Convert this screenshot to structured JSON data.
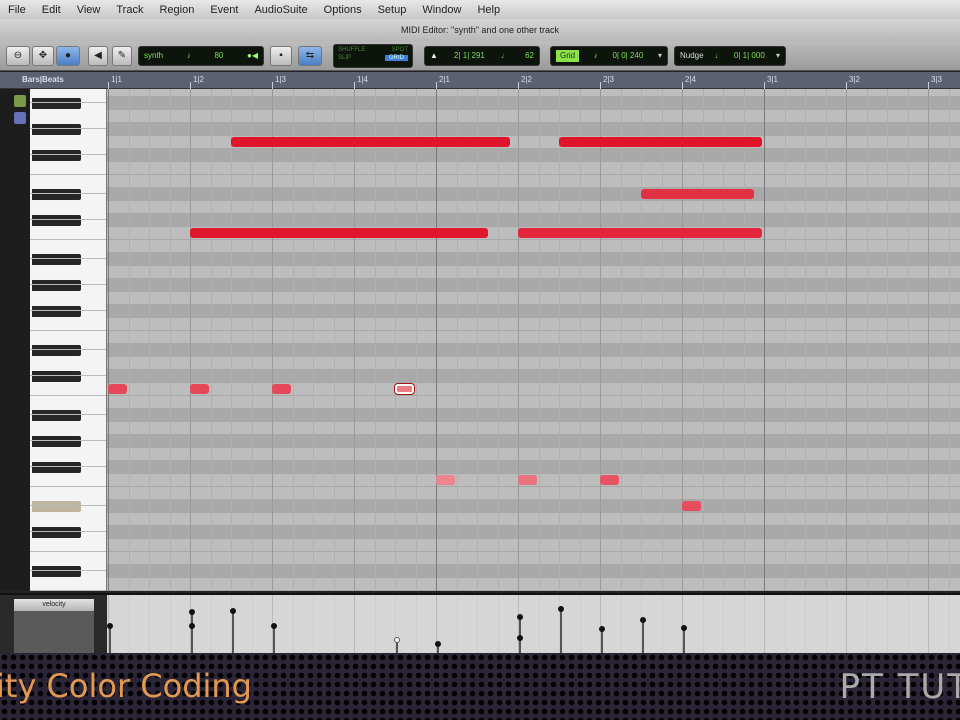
{
  "menu": [
    "File",
    "Edit",
    "View",
    "Track",
    "Region",
    "Event",
    "AudioSuite",
    "Options",
    "Setup",
    "Window",
    "Help"
  ],
  "window_title": "MIDI Editor: \"synth\" and one other track",
  "toolbar": {
    "track_lcd": {
      "name": "synth",
      "value": "80"
    },
    "mode_lcd": {
      "top_left": "SHUFFLE",
      "top_right": "SPOT",
      "bottom_left": "SLIP",
      "bottom_right": "GRID"
    },
    "cursor_lcd": {
      "position": "2| 1| 291",
      "value": "62"
    },
    "grid_lcd": {
      "label": "Grid",
      "value": "0| 0| 240"
    },
    "nudge_lcd": {
      "label": "Nudge",
      "value": "0| 1| 000"
    }
  },
  "ruler": {
    "label": "Bars|Beats",
    "ticks": [
      "1|1",
      "1|2",
      "1|3",
      "1|4",
      "2|1",
      "2|2",
      "2|3",
      "2|4",
      "3|1",
      "3|2",
      "3|3"
    ]
  },
  "piano": {
    "black_rows": [
      0,
      2,
      4,
      7,
      9,
      12,
      14,
      16,
      19,
      21,
      24,
      26,
      28,
      31,
      33,
      36
    ],
    "highlight_row": 31
  },
  "colors": {
    "note_high": "#e0152c",
    "note_low": "#ec8c94",
    "accent_green": "#8ee04a"
  },
  "notes": [
    {
      "row": 22,
      "start": 0,
      "end": 0.25,
      "velocity": 63
    },
    {
      "row": 10,
      "start": 1,
      "end": 4.66,
      "velocity": 99
    },
    {
      "row": 22,
      "start": 1,
      "end": 1.25,
      "velocity": 63
    },
    {
      "row": 3,
      "start": 1.5,
      "end": 4.93,
      "velocity": 101
    },
    {
      "row": 22,
      "start": 2,
      "end": 2.25,
      "velocity": 63
    },
    {
      "row": 22,
      "start": 3.5,
      "end": 3.75,
      "velocity": 28,
      "selected": true
    },
    {
      "row": 29,
      "start": 4,
      "end": 4.25,
      "velocity": 19
    },
    {
      "row": 10,
      "start": 5,
      "end": 8,
      "velocity": 87
    },
    {
      "row": 29,
      "start": 5,
      "end": 5.25,
      "velocity": 33
    },
    {
      "row": 3,
      "start": 5.5,
      "end": 8,
      "velocity": 106
    },
    {
      "row": 29,
      "start": 6,
      "end": 6.25,
      "velocity": 56
    },
    {
      "row": 7,
      "start": 6.5,
      "end": 7.9,
      "velocity": 80
    },
    {
      "row": 31,
      "start": 7,
      "end": 7.25,
      "velocity": 59
    }
  ],
  "velocity_lane": {
    "selector": "velocity"
  },
  "banner": {
    "title": "ity Color Coding",
    "logo": "PT TUT"
  }
}
